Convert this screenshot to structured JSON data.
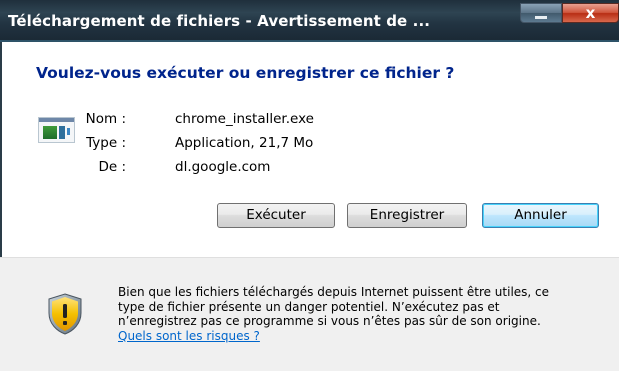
{
  "window": {
    "title": "Téléchargement de fichiers - Avertissement de ...",
    "close_label": "x"
  },
  "question": "Voulez-vous exécuter ou enregistrer ce fichier ?",
  "file_info": {
    "icon": "application-file-icon",
    "rows": [
      {
        "label": "Nom :",
        "value": "chrome_installer.exe"
      },
      {
        "label": "Type :",
        "value": "Application, 21,7 Mo"
      },
      {
        "label": "De :",
        "value": "dl.google.com"
      }
    ]
  },
  "buttons": {
    "run": "Exécuter",
    "save": "Enregistrer",
    "cancel": "Annuler"
  },
  "warning": {
    "icon": "security-shield-icon",
    "lines": [
      "Bien que les fichiers téléchargés depuis Internet puissent être utiles, ce",
      "type de fichier présente un danger potentiel. N’exécutez pas et",
      "n’enregistrez pas ce programme si vous n’êtes pas sûr de son origine."
    ],
    "link": "Quels sont les risques ?"
  },
  "colors": {
    "question": "#00248c",
    "link": "#0066cc",
    "footer_bg": "#f0f0f0",
    "shield_yellow": "#f5c000"
  }
}
